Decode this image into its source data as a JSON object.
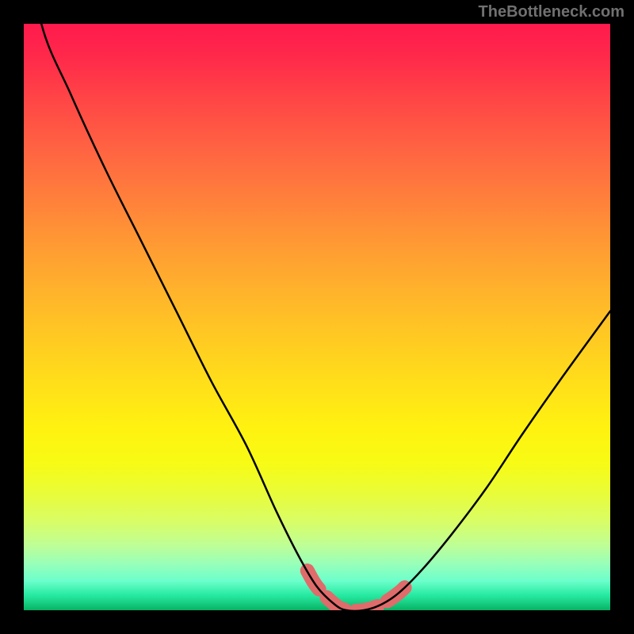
{
  "watermark": "TheBottleneck.com",
  "chart_data": {
    "type": "line",
    "title": "",
    "xlabel": "",
    "ylabel": "",
    "xlim": [
      0,
      100
    ],
    "ylim": [
      0,
      100
    ],
    "x": [
      0,
      3,
      8,
      14,
      20,
      26,
      32,
      38,
      43,
      47,
      50,
      53,
      55,
      58,
      61,
      64,
      68,
      73,
      79,
      85,
      92,
      100
    ],
    "values": [
      118,
      100,
      88,
      75,
      63,
      51,
      39,
      28,
      17,
      9,
      4,
      1,
      0,
      0,
      1,
      3,
      7,
      13,
      21,
      30,
      40,
      51
    ],
    "series": [
      {
        "name": "bottleneck-curve",
        "color": "#000000"
      },
      {
        "name": "optimal-zone-highlight",
        "color": "#e06b6b"
      }
    ],
    "gradient_stops": [
      {
        "pos": 0,
        "color": "#ff1a4d"
      },
      {
        "pos": 50,
        "color": "#ffc823"
      },
      {
        "pos": 75,
        "color": "#f7fb15"
      },
      {
        "pos": 100,
        "color": "#07b263"
      }
    ]
  }
}
